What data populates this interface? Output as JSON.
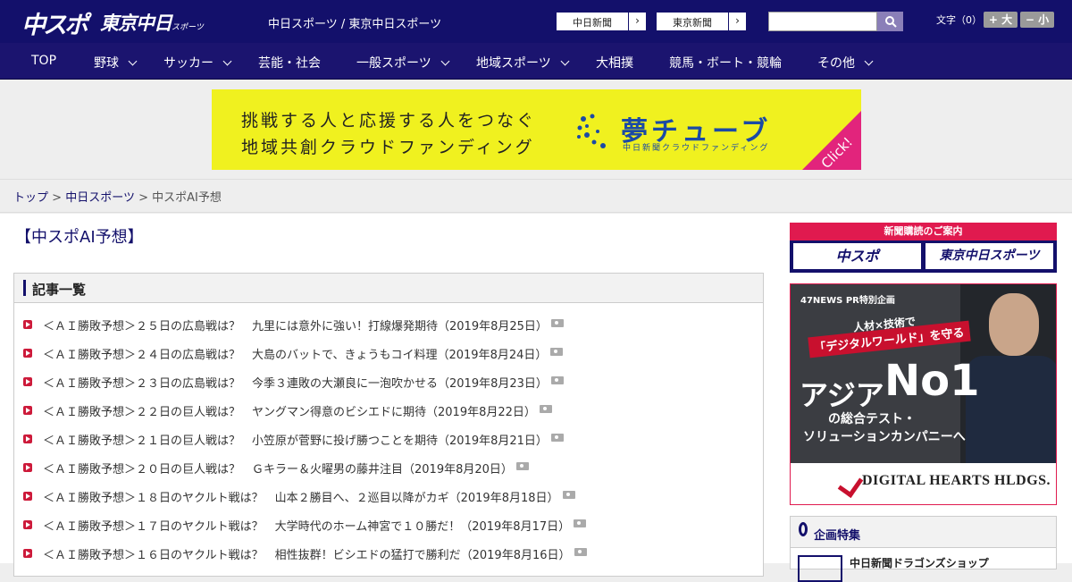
{
  "header": {
    "logo_main": "中スポ",
    "logo_secondary": "東京中日",
    "logo_secondary_small": "スポーツ",
    "site_titles": "中日スポーツ / 東京中日スポーツ",
    "paper_links": [
      "中日新聞",
      "東京新聞"
    ],
    "search_placeholder": "",
    "font_size_label": "文字（0）",
    "font_size_up": "+ 大",
    "font_size_down": "− 小"
  },
  "nav": {
    "items": [
      {
        "label": "TOP",
        "dropdown": false
      },
      {
        "label": "野球",
        "dropdown": true
      },
      {
        "label": "サッカー",
        "dropdown": true
      },
      {
        "label": "芸能・社会",
        "dropdown": false
      },
      {
        "label": "一般スポーツ",
        "dropdown": true
      },
      {
        "label": "地域スポーツ",
        "dropdown": true
      },
      {
        "label": "大相撲",
        "dropdown": false
      },
      {
        "label": "競馬・ボート・競輪",
        "dropdown": false
      },
      {
        "label": "その他",
        "dropdown": true
      }
    ]
  },
  "ad": {
    "line1": "挑戦する人と応援する人をつなぐ",
    "line2": "地域共創クラウドファンディング",
    "brand": "夢チューブ",
    "brand_sub": "中日新聞クラウドファンディング",
    "click": "Click!",
    "colors": {
      "background": "#f0f11f",
      "brand": "#1b4aa5",
      "corner": "#e2247c"
    }
  },
  "breadcrumb": {
    "home": "トップ",
    "sep": ">",
    "section": "中日スポーツ",
    "current": "中スポAI予想"
  },
  "page": {
    "title": "【中スポAI予想】",
    "list_heading": "記事一覧"
  },
  "articles": [
    "＜ＡＩ勝敗予想＞２５日の広島戦は？　九里には意外に強い！打線爆発期待（2019年8月25日）",
    "＜ＡＩ勝敗予想＞２４日の広島戦は？　大島のバットで、きょうもコイ料理（2019年8月24日）",
    "＜ＡＩ勝敗予想＞２３日の広島戦は？　今季３連敗の大瀬良に一泡吹かせる（2019年8月23日）",
    "＜ＡＩ勝敗予想＞２２日の巨人戦は？　ヤングマン得意のビシエドに期待（2019年8月22日）",
    "＜ＡＩ勝敗予想＞２１日の巨人戦は？　小笠原が菅野に投げ勝つことを期待（2019年8月21日）",
    "＜ＡＩ勝敗予想＞２０日の巨人戦は？　Ｇキラー＆火曜男の藤井注目（2019年8月20日）",
    "＜ＡＩ勝敗予想＞１８日のヤクルト戦は？　山本２勝目へ、２巡目以降がカギ（2019年8月18日）",
    "＜ＡＩ勝敗予想＞１７日のヤクルト戦は？　大学時代のホーム神宮で１０勝だ！（2019年8月17日）",
    "＜ＡＩ勝敗予想＞１６日のヤクルト戦は？　相性抜群！ビシエドの猛打で勝利だ（2019年8月16日）"
  ],
  "sidebar": {
    "subscribe_head": "新聞購読のご案内",
    "subscribe_buttons": [
      "中スポ",
      "東京中日スポーツ"
    ],
    "pr": {
      "label": "47NEWS PR特別企画",
      "line1": "人材×技術で",
      "line2": "「デジタルワールド」を守る",
      "asia": "アジア",
      "no1": "No1",
      "sub1": "の総合テスト・",
      "sub2": "ソリューションカンパニーへ",
      "logo": "DIGITAL HEARTS HLDGS."
    },
    "feature_title": "企画特集",
    "feature_item": "中日新聞ドラゴンズショップ"
  },
  "colors": {
    "brand_navy": "#13106b",
    "accent_red": "#e01a4f"
  }
}
